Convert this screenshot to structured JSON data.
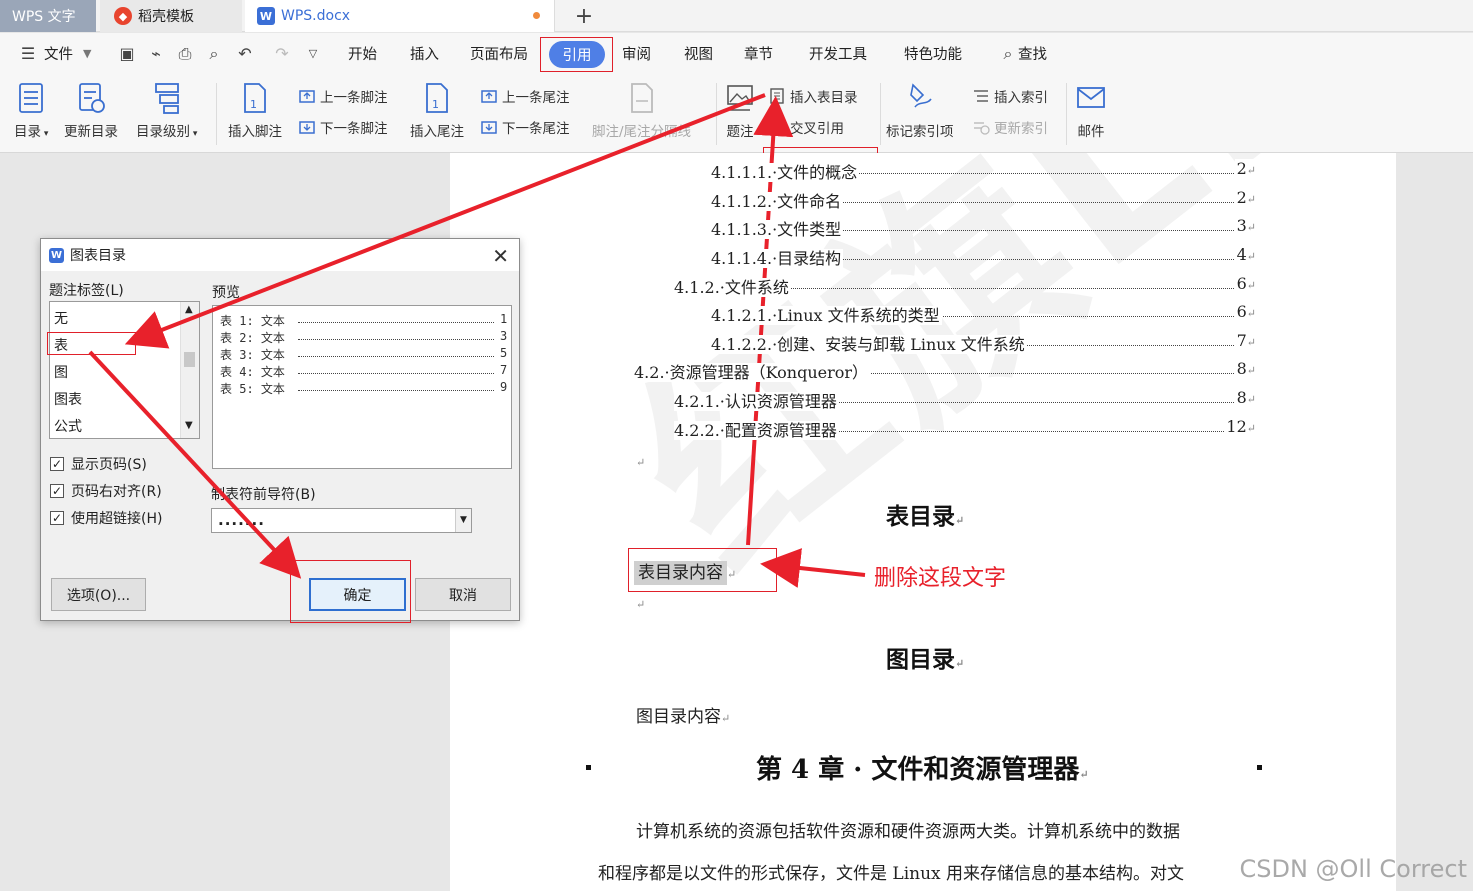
{
  "tabs": [
    {
      "label": "WPS 文字"
    },
    {
      "label": "稻壳模板"
    },
    {
      "label": "WPS.docx"
    }
  ],
  "menu": {
    "file": "文件",
    "items": [
      "开始",
      "插入",
      "页面布局",
      "引用",
      "审阅",
      "视图",
      "章节",
      "开发工具",
      "特色功能"
    ],
    "active": "引用",
    "search": "查找"
  },
  "ribbon": {
    "toc": "目录",
    "update_toc": "更新目录",
    "toc_level": "目录级别",
    "insert_footnote": "插入脚注",
    "prev_footnote": "上一条脚注",
    "next_footnote": "下一条脚注",
    "insert_endnote": "插入尾注",
    "prev_endnote": "上一条尾注",
    "next_endnote": "下一条尾注",
    "note_separator": "脚注/尾注分隔线",
    "caption": "题注",
    "insert_table_of_figures": "插入表目录",
    "cross_reference": "交叉引用",
    "mark_index_entry": "标记索引项",
    "insert_index": "插入索引",
    "update_index": "更新索引",
    "mail": "邮件"
  },
  "document": {
    "toc_entries": [
      {
        "num": "4.1.1.1.",
        "text": "文件的概念",
        "page": "2"
      },
      {
        "num": "4.1.1.2.",
        "text": "文件命名",
        "page": "2"
      },
      {
        "num": "4.1.1.3.",
        "text": "文件类型",
        "page": "3"
      },
      {
        "num": "4.1.1.4.",
        "text": "目录结构",
        "page": "4"
      },
      {
        "num": "4.1.2.",
        "text": "文件系统",
        "page": "6"
      },
      {
        "num": "4.1.2.1.",
        "text": "Linux 文件系统的类型",
        "page": "6"
      },
      {
        "num": "4.1.2.2.",
        "text": "创建、安装与卸载 Linux 文件系统",
        "page": "7"
      },
      {
        "num": "4.2.",
        "text": "资源管理器（Konqueror）",
        "page": "8"
      },
      {
        "num": "4.2.1.",
        "text": "认识资源管理器",
        "page": "8"
      },
      {
        "num": "4.2.2.",
        "text": "配置资源管理器",
        "page": "12"
      }
    ],
    "table_toc_heading": "表目录",
    "table_toc_content": "表目录内容",
    "figure_toc_heading": "图目录",
    "figure_toc_content": "图目录内容",
    "chapter_heading": "第 4 章 · 文件和资源管理器",
    "para1": "计算机系统的资源包括软件资源和硬件资源两大类。计算机系统中的数据",
    "para2": "和程序都是以文件的形式保存，文件是 Linux 用来存储信息的基本结构。对文",
    "watermark": "红旗Linux"
  },
  "dialog": {
    "title": "图表目录",
    "caption_label": "题注标签(L)",
    "labels": [
      "无",
      "表",
      "图",
      "图表",
      "公式"
    ],
    "selected_label": "表",
    "preview_label": "预览",
    "preview_lines": [
      {
        "text": "表 1: 文本",
        "page": "1"
      },
      {
        "text": "表 2: 文本",
        "page": "3"
      },
      {
        "text": "表 3: 文本",
        "page": "5"
      },
      {
        "text": "表 4: 文本",
        "page": "7"
      },
      {
        "text": "表 5: 文本",
        "page": "9"
      }
    ],
    "show_page_numbers": "显示页码(S)",
    "right_align": "页码右对齐(R)",
    "use_hyperlinks": "使用超链接(H)",
    "tab_leader_label": "制表符前导符(B)",
    "tab_leader_value": ".......",
    "options_button": "选项(O)...",
    "ok_button": "确定",
    "cancel_button": "取消"
  },
  "annotation": {
    "delete_text": "删除这段文字",
    "color": "#e8212b"
  },
  "source_watermark": "CSDN @Oll Correct"
}
